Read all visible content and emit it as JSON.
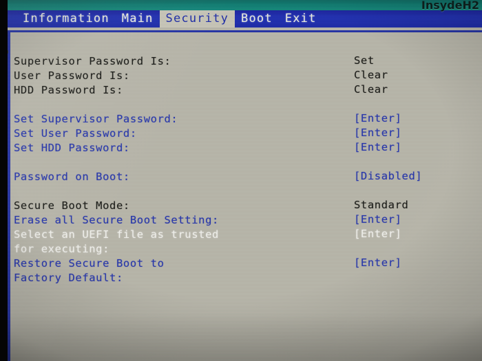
{
  "bios": {
    "brand": "InsydeH2",
    "active_tab": "Security"
  },
  "menu": {
    "tabs": [
      {
        "label": "Information",
        "selected": false
      },
      {
        "label": "Main",
        "selected": false
      },
      {
        "label": "Security",
        "selected": true
      },
      {
        "label": "Boot",
        "selected": false
      },
      {
        "label": "Exit",
        "selected": false
      }
    ]
  },
  "security": {
    "status_rows": [
      {
        "label": "Supervisor Password Is:",
        "value": "Set",
        "state": "dark"
      },
      {
        "label": "User Password Is:",
        "value": "Clear",
        "state": "dark"
      },
      {
        "label": "HDD Password Is:",
        "value": "Clear",
        "state": "dark"
      }
    ],
    "password_actions": [
      {
        "label": "Set Supervisor Password:",
        "value": "[Enter]",
        "state": "blue"
      },
      {
        "label": "Set User Password:",
        "value": "[Enter]",
        "state": "blue"
      },
      {
        "label": "Set HDD Password:",
        "value": "[Enter]",
        "state": "blue"
      }
    ],
    "password_on_boot": {
      "label": "Password on Boot:",
      "value": "[Disabled]",
      "state": "blue"
    },
    "secure_boot": {
      "mode": {
        "label": "Secure Boot Mode:",
        "value": "Standard",
        "state": "dark"
      },
      "erase": {
        "label": "Erase all Secure Boot Setting:",
        "value": "[Enter]",
        "state": "blue"
      },
      "select_uefi": {
        "label_line1": "Select an UEFI file as trusted",
        "label_line2": "for executing:",
        "value": "[Enter]",
        "state": "white"
      },
      "restore": {
        "label_line1": "Restore Secure Boot to",
        "label_line2": "Factory Default:",
        "value": "[Enter]",
        "state": "blue"
      }
    }
  },
  "colors": {
    "header_teal": "#0f7d72",
    "menu_blue": "#2030b4",
    "panel_bg": "#b9b7ab",
    "text_dark": "#191a16",
    "text_blue": "#2636ad",
    "text_white": "#f3f3ee",
    "tab_selected_bg": "#c8c6b8"
  }
}
